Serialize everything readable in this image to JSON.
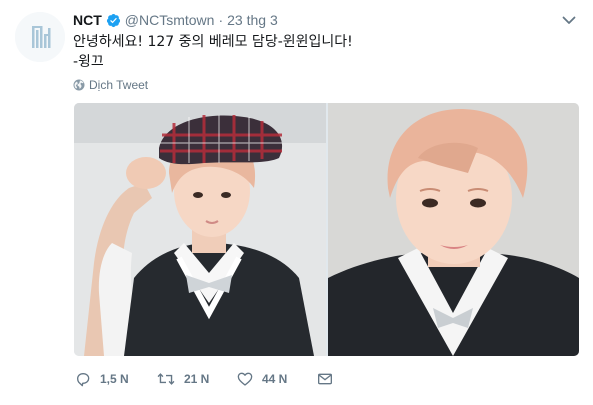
{
  "tweet": {
    "display_name": "NCT",
    "handle": "@NCTsmtown",
    "separator": "·",
    "timestamp": "23 thg 3",
    "text_lines": [
      "안녕하세요! 127 중의 베레모 담당-윈윈입니다!",
      "-윙끄"
    ],
    "translate_label": "Dịch Tweet",
    "verified": true
  },
  "media": {
    "photo_count": 2
  },
  "actions": {
    "reply_count": "1,5 N",
    "retweet_count": "21 N",
    "like_count": "44 N"
  },
  "colors": {
    "accent": "#1da1f2",
    "secondary_text": "#657786",
    "primary_text": "#14171a",
    "logo": "#a9c6d8"
  },
  "icons": {
    "avatar": "nct-logo",
    "verified": "verified-badge-icon",
    "caret": "chevron-down-icon",
    "translate": "globe-icon",
    "reply": "reply-icon",
    "retweet": "retweet-icon",
    "like": "heart-icon",
    "dm": "envelope-icon"
  }
}
